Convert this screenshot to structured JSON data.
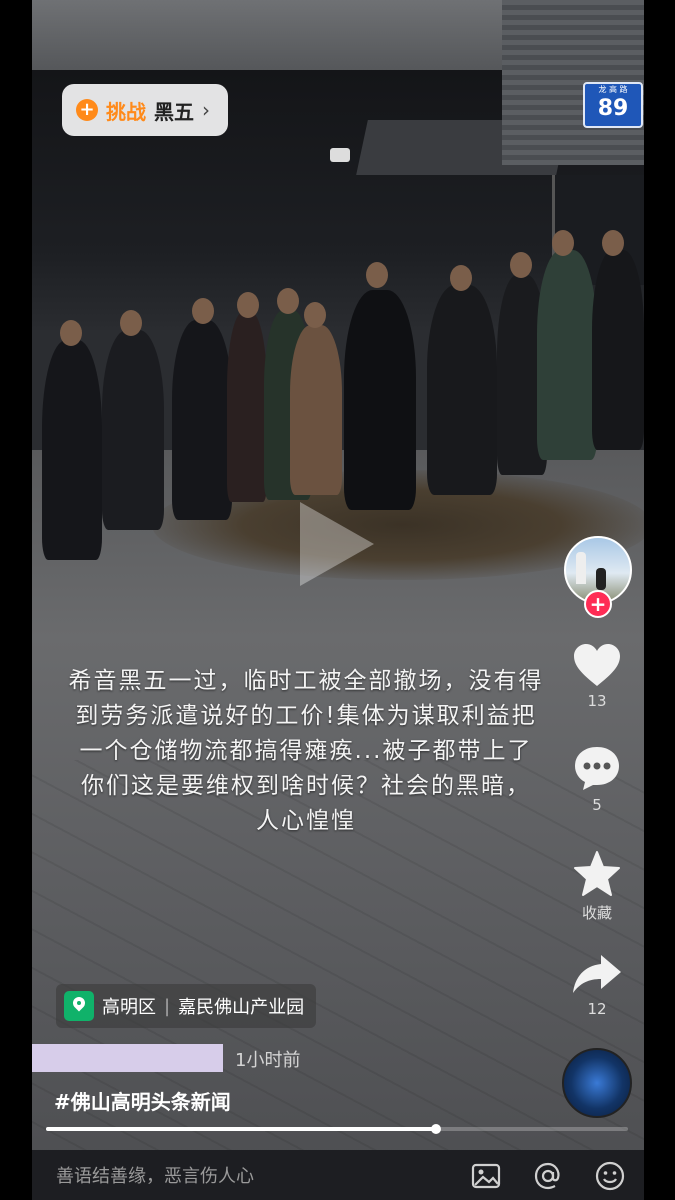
{
  "challenge": {
    "label": "挑战",
    "topic": "黑五",
    "plus": "+",
    "chevron": "›"
  },
  "sign": {
    "small": "龙 高 路",
    "number": "89"
  },
  "caption": {
    "lines": [
      "希音黑五一过，临时工被全部撤场，没有得",
      "到劳务派遣说好的工价!集体为谋取利益把",
      "一个仓储物流都搞得瘫痪...被子都带上了",
      "你们这是要维权到啥时候？社会的黑暗，",
      "人心惶惶"
    ]
  },
  "rail": {
    "follow_plus": "+",
    "likes": "13",
    "comments": "5",
    "favorite_label": "收藏",
    "shares": "12"
  },
  "location": {
    "district": "高明区",
    "place": "嘉民佛山产业园",
    "separator": "|"
  },
  "post": {
    "time": "1小时前",
    "hashtag": "#佛山高明头条新闻"
  },
  "progress": {
    "fraction": 0.67
  },
  "comment_bar": {
    "placeholder": "善语结善缘，恶言伤人心"
  },
  "colors": {
    "accent_orange": "#ff8a1a",
    "follow_red": "#fe2c55",
    "location_green": "#10b26a"
  }
}
